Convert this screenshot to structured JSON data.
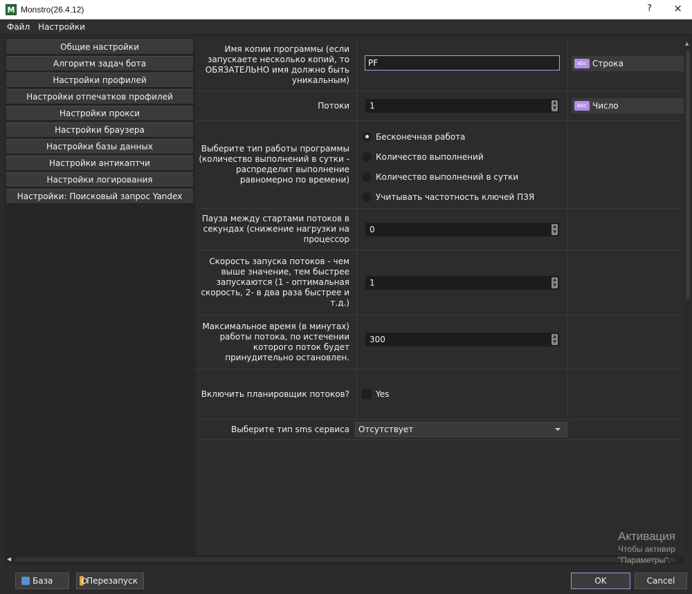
{
  "window": {
    "icon_letter": "M",
    "title": "Monstro(26.4.12)",
    "help": "?",
    "close": "×"
  },
  "menu": [
    "Файл",
    "Настройки"
  ],
  "sidebar": {
    "items": [
      "Общие настройки",
      "Алгоритм задач бота",
      "Настройки профилей",
      "Настройки отпечатков профилей",
      "Настройки прокси",
      "Настройки браузера",
      "Настройки базы данных",
      "Настройки антикаптчи",
      "Настройки логирования",
      "Настройки: Поисковый запрос Yandex"
    ]
  },
  "form": {
    "copy_name": {
      "label": "Имя копии программы (если запускаете несколько копий, то ОБЯЗАТЕЛЬНО имя должно быть уникальным)",
      "value": "PF",
      "type_icon": "abc",
      "type": "Строка"
    },
    "threads": {
      "label": "Потоки",
      "value": "1",
      "type_icon": "abc",
      "type": "Число"
    },
    "work_type": {
      "label": "Выберите тип работы программы (количество выполнений в сутки - распределит выполнение равномерно по времени)",
      "options": [
        "Бесконечная работа",
        "Количество выполнений",
        "Количество выполнений в сутки",
        "Учитывать частотность ключей ПЗЯ"
      ],
      "selected_index": 0
    },
    "pause": {
      "label": "Пауза между стартами потоков в секундах (снижение нагрузки на процессор",
      "value": "0"
    },
    "speed": {
      "label": "Скорость запуска потоков - чем выше значение, тем быстрее запускаются (1 - оптимальная скорость, 2- в два раза быстрее и т.д.)",
      "value": "1"
    },
    "max_time": {
      "label": "Максимальное время (в минутах) работы потока, по истечении которого поток будет принудительно остановлен.",
      "value": "300"
    },
    "scheduler": {
      "label": "Включить планировщик потоков?",
      "checkbox_label": "Yes",
      "checked": false
    },
    "sms": {
      "label": "Выберите тип sms сервиса",
      "value": "Отсутствует"
    }
  },
  "watermark": {
    "title": "Активация",
    "line1": "Чтобы активир",
    "line2": "\"Параметры\"."
  },
  "bottom": {
    "db_button": "База",
    "restart_button": "Перезапуск",
    "ok_button": "OK",
    "cancel_button": "Cancel"
  },
  "colors": {
    "accent": "#b48ce6",
    "background": "#2b2b2b"
  }
}
